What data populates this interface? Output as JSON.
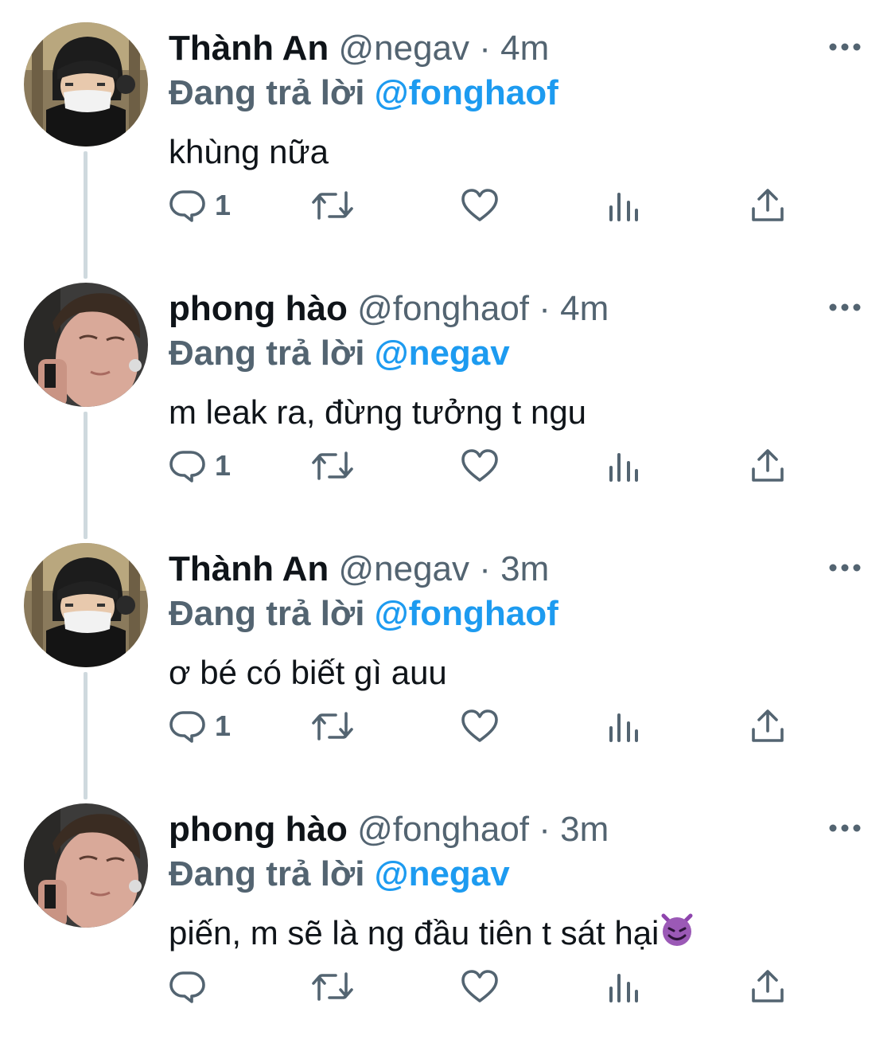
{
  "thread": [
    {
      "display_name": "Thành An",
      "handle": "@negav",
      "separator": "·",
      "time": "4m",
      "reply_prefix": "Đang trả lời",
      "reply_to": "@fonghaof",
      "text": "khùng nữa",
      "reply_count": "1",
      "avatar": "avatar-thanh-an"
    },
    {
      "display_name": "phong hào",
      "handle": "@fonghaof",
      "separator": "·",
      "time": "4m",
      "reply_prefix": "Đang trả lời",
      "reply_to": "@negav",
      "text": "m leak ra, đừng tưởng t ngu",
      "reply_count": "1",
      "avatar": "avatar-phong-hao"
    },
    {
      "display_name": "Thành An",
      "handle": "@negav",
      "separator": "·",
      "time": "3m",
      "reply_prefix": "Đang trả lời",
      "reply_to": "@fonghaof",
      "text": "ơ bé có biết gì auu",
      "reply_count": "1",
      "avatar": "avatar-thanh-an"
    },
    {
      "display_name": "phong hào",
      "handle": "@fonghaof",
      "separator": "·",
      "time": "3m",
      "reply_prefix": "Đang trả lời",
      "reply_to": "@negav",
      "text": "piến, m sẽ là ng đầu tiên t sát hại",
      "trailing_emoji": "smiling-devil-emoji",
      "reply_count": "",
      "avatar": "avatar-phong-hao"
    }
  ],
  "icons": {
    "reply": "reply-icon",
    "retweet": "retweet-icon",
    "like": "heart-icon",
    "views": "views-icon",
    "share": "share-icon",
    "more": "more-icon"
  },
  "colors": {
    "text": "#0f1419",
    "secondary": "#536471",
    "accent": "#1d9bf0",
    "thread_line": "#cfd9de",
    "background": "#ffffff"
  }
}
